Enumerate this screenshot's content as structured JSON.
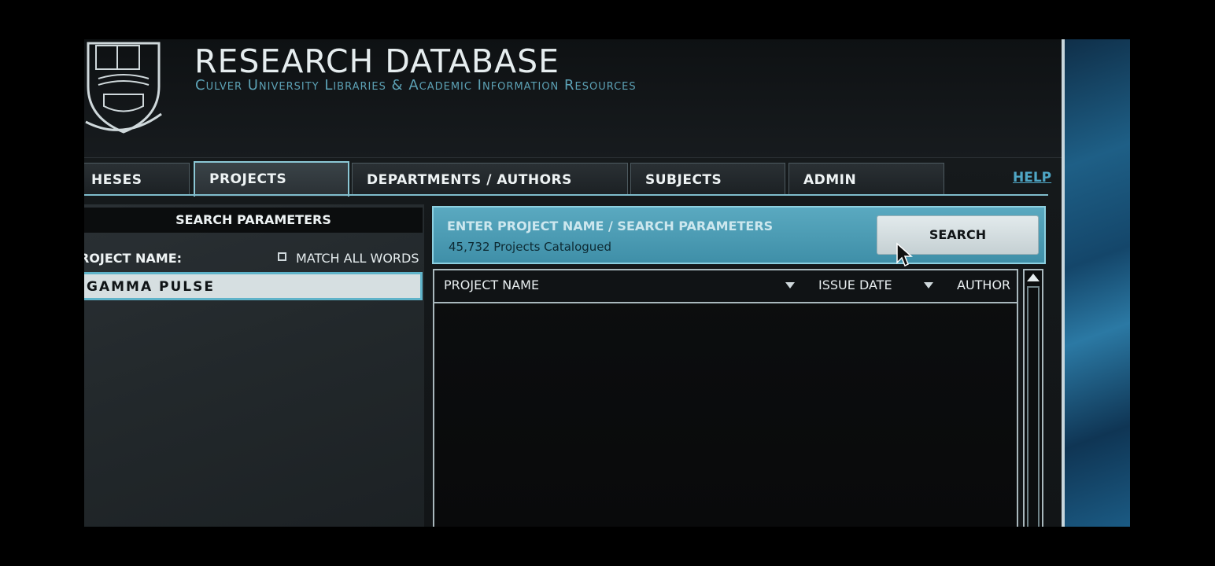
{
  "header": {
    "title": "RESEARCH DATABASE",
    "subtitle": "Culver University Libraries & Academic Information Resources"
  },
  "tabs": [
    {
      "label": "HESES",
      "active": false
    },
    {
      "label": "PROJECTS",
      "active": true
    },
    {
      "label": "DEPARTMENTS / AUTHORS",
      "active": false
    },
    {
      "label": "SUBJECTS",
      "active": false
    },
    {
      "label": "ADMIN",
      "active": false
    }
  ],
  "help_label": "HELP",
  "left_panel": {
    "heading": "SEARCH PARAMETERS",
    "field_label": "ROJECT NAME:",
    "match_all_label": "MATCH ALL WORDS",
    "match_all_checked": false,
    "field_value": "GAMMA PULSE"
  },
  "search": {
    "banner_title": "ENTER PROJECT NAME / SEARCH PARAMETERS",
    "count_text": "45,732 Projects Catalogued",
    "button_label": "SEARCH"
  },
  "results": {
    "columns": [
      "PROJECT NAME",
      "ISSUE DATE",
      "AUTHOR"
    ],
    "rows": []
  },
  "icons": {
    "crest": "university-crest-icon",
    "sort": "sort-down-arrow-icon",
    "scroll_up": "scroll-up-arrow-icon",
    "cursor": "mouse-pointer-icon"
  },
  "colors": {
    "accent": "#5aa9c0",
    "subtitle": "#5da2b6",
    "help_link": "#4fa6c5"
  }
}
